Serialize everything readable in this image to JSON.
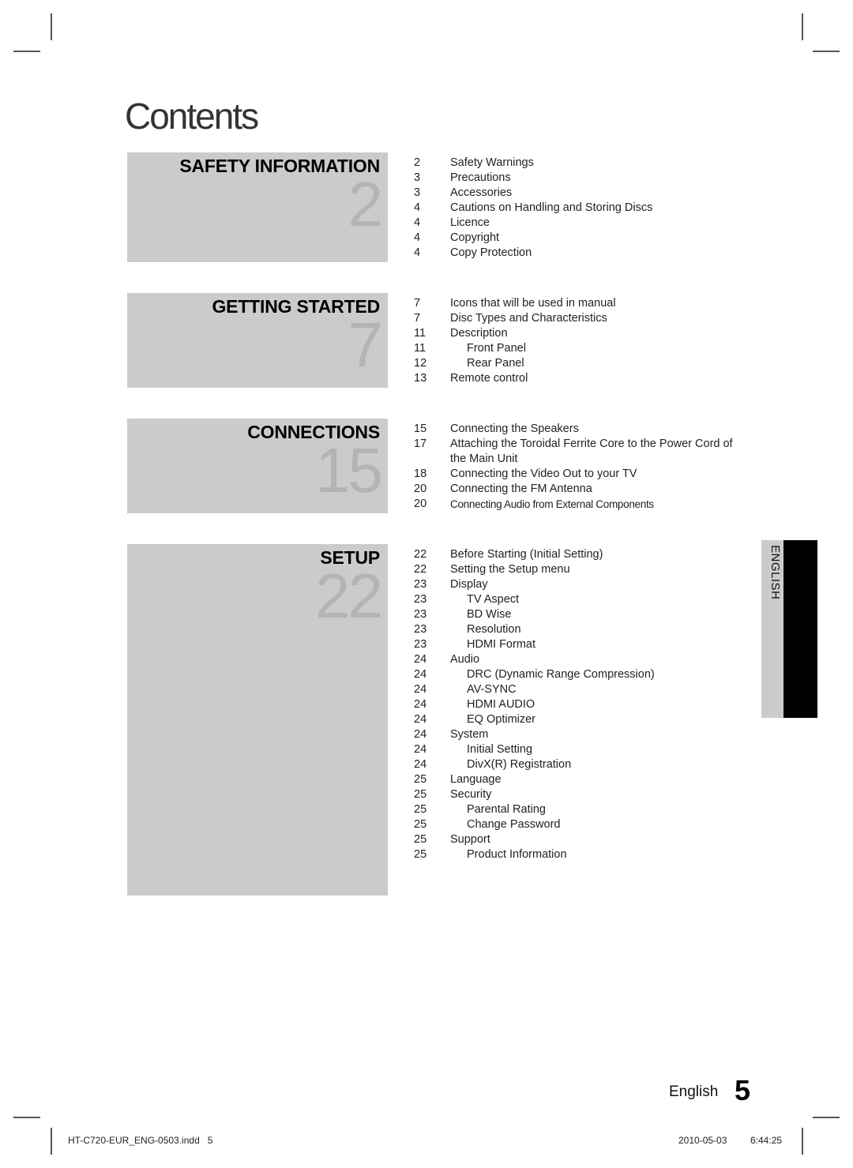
{
  "page": {
    "title": "Contents",
    "footer_language": "English",
    "footer_page_number": "5",
    "side_tab_label": "ENGLISH"
  },
  "slug": {
    "file_name": "HT-C720-EUR_ENG-0503.indd",
    "file_page": "5",
    "date": "2010-05-03",
    "time": "6:44:25"
  },
  "sections": [
    {
      "title": "SAFETY INFORMATION",
      "number": "2",
      "items": [
        {
          "page": "2",
          "label": "Safety Warnings",
          "level": 1
        },
        {
          "page": "3",
          "label": "Precautions",
          "level": 1
        },
        {
          "page": "3",
          "label": "Accessories",
          "level": 1
        },
        {
          "page": "4",
          "label": "Cautions on Handling and Storing Discs",
          "level": 1
        },
        {
          "page": "4",
          "label": "Licence",
          "level": 1
        },
        {
          "page": "4",
          "label": "Copyright",
          "level": 1
        },
        {
          "page": "4",
          "label": "Copy Protection",
          "level": 1
        }
      ]
    },
    {
      "title": "GETTING STARTED",
      "number": "7",
      "items": [
        {
          "page": "7",
          "label": "Icons that will be used in manual",
          "level": 1
        },
        {
          "page": "7",
          "label": "Disc Types and Characteristics",
          "level": 1
        },
        {
          "page": "11",
          "label": "Description",
          "level": 1
        },
        {
          "page": "11",
          "label": "Front Panel",
          "level": 2
        },
        {
          "page": "12",
          "label": "Rear Panel",
          "level": 2
        },
        {
          "page": "13",
          "label": "Remote control",
          "level": 1
        }
      ]
    },
    {
      "title": "CONNECTIONS",
      "number": "15",
      "items": [
        {
          "page": "15",
          "label": "Connecting the Speakers",
          "level": 1
        },
        {
          "page": "17",
          "label": "Attaching the Toroidal Ferrite Core to the Power Cord of the Main Unit",
          "level": 1
        },
        {
          "page": "18",
          "label": "Connecting the Video Out to your TV",
          "level": 1
        },
        {
          "page": "20",
          "label": "Connecting the FM Antenna",
          "level": 1
        },
        {
          "page": "20",
          "label": "Connecting Audio from External Components",
          "level": 1
        }
      ]
    },
    {
      "title": "SETUP",
      "number": "22",
      "items": [
        {
          "page": "22",
          "label": "Before Starting (Initial Setting)",
          "level": 1
        },
        {
          "page": "22",
          "label": "Setting the Setup menu",
          "level": 1
        },
        {
          "page": "23",
          "label": "Display",
          "level": 1
        },
        {
          "page": "23",
          "label": "TV Aspect",
          "level": 2
        },
        {
          "page": "23",
          "label": "BD Wise",
          "level": 2
        },
        {
          "page": "23",
          "label": "Resolution",
          "level": 2
        },
        {
          "page": "23",
          "label": "HDMI Format",
          "level": 2
        },
        {
          "page": "24",
          "label": "Audio",
          "level": 1
        },
        {
          "page": "24",
          "label": "DRC (Dynamic Range Compression)",
          "level": 2
        },
        {
          "page": "24",
          "label": "AV-SYNC",
          "level": 2
        },
        {
          "page": "24",
          "label": "HDMI AUDIO",
          "level": 2
        },
        {
          "page": "24",
          "label": "EQ Optimizer",
          "level": 2
        },
        {
          "page": "24",
          "label": "System",
          "level": 1
        },
        {
          "page": "24",
          "label": "Initial Setting",
          "level": 2
        },
        {
          "page": "24",
          "label": "DivX(R) Registration",
          "level": 2
        },
        {
          "page": "25",
          "label": "Language",
          "level": 1
        },
        {
          "page": "25",
          "label": "Security",
          "level": 1
        },
        {
          "page": "25",
          "label": "Parental Rating",
          "level": 2
        },
        {
          "page": "25",
          "label": "Change Password",
          "level": 2
        },
        {
          "page": "25",
          "label": "Support",
          "level": 1
        },
        {
          "page": "25",
          "label": "Product Information",
          "level": 2
        }
      ]
    }
  ]
}
